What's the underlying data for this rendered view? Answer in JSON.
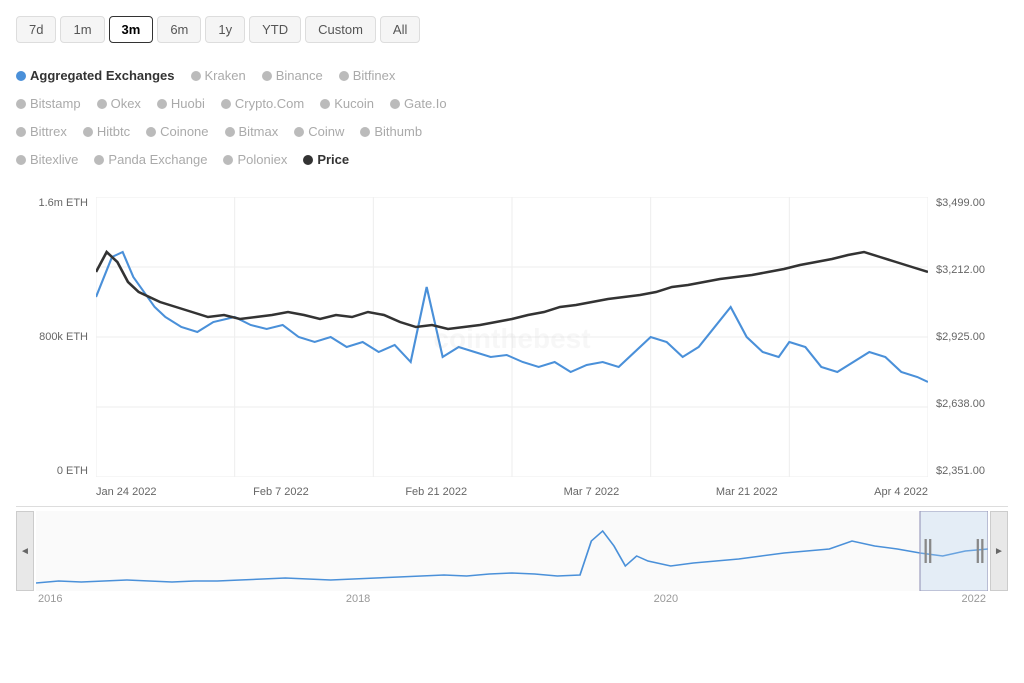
{
  "timeRange": {
    "buttons": [
      {
        "label": "7d",
        "active": false
      },
      {
        "label": "1m",
        "active": false
      },
      {
        "label": "3m",
        "active": true
      },
      {
        "label": "6m",
        "active": false
      },
      {
        "label": "1y",
        "active": false
      },
      {
        "label": "YTD",
        "active": false
      },
      {
        "label": "Custom",
        "active": false
      },
      {
        "label": "All",
        "active": false
      }
    ]
  },
  "legend": {
    "rows": [
      [
        {
          "label": "Aggregated Exchanges",
          "type": "blue",
          "bold": true
        },
        {
          "label": "Kraken",
          "type": "gray",
          "bold": false
        },
        {
          "label": "Binance",
          "type": "gray",
          "bold": false
        },
        {
          "label": "Bitfinex",
          "type": "gray",
          "bold": false
        }
      ],
      [
        {
          "label": "Bitstamp",
          "type": "gray",
          "bold": false
        },
        {
          "label": "Okex",
          "type": "gray",
          "bold": false
        },
        {
          "label": "Huobi",
          "type": "gray",
          "bold": false
        },
        {
          "label": "Crypto.Com",
          "type": "gray",
          "bold": false
        },
        {
          "label": "Kucoin",
          "type": "gray",
          "bold": false
        },
        {
          "label": "Gate.Io",
          "type": "gray",
          "bold": false
        }
      ],
      [
        {
          "label": "Bittrex",
          "type": "gray",
          "bold": false
        },
        {
          "label": "Hitbtc",
          "type": "gray",
          "bold": false
        },
        {
          "label": "Coinone",
          "type": "gray",
          "bold": false
        },
        {
          "label": "Bitmax",
          "type": "gray",
          "bold": false
        },
        {
          "label": "Coinw",
          "type": "gray",
          "bold": false
        },
        {
          "label": "Bithumb",
          "type": "gray",
          "bold": false
        }
      ],
      [
        {
          "label": "Bitexlive",
          "type": "gray",
          "bold": false
        },
        {
          "label": "Panda Exchange",
          "type": "gray",
          "bold": false
        },
        {
          "label": "Poloniex",
          "type": "gray",
          "bold": false
        },
        {
          "label": "Price",
          "type": "dark",
          "bold": true
        }
      ]
    ]
  },
  "yAxisLeft": [
    "1.6m ETH",
    "800k ETH",
    "0 ETH"
  ],
  "yAxisRight": [
    "$3,499.00",
    "$3,212.00",
    "$2,925.00",
    "$2,638.00",
    "$2,351.00"
  ],
  "xAxisLabels": [
    "Jan 24 2022",
    "Feb 7 2022",
    "Feb 21 2022",
    "Mar 7 2022",
    "Mar 21 2022",
    "Apr 4 2022"
  ],
  "miniXLabels": [
    "2016",
    "2018",
    "2020",
    "2022"
  ],
  "watermark": "cointhebest",
  "scrollLeft": "◄",
  "scrollRight": "►"
}
